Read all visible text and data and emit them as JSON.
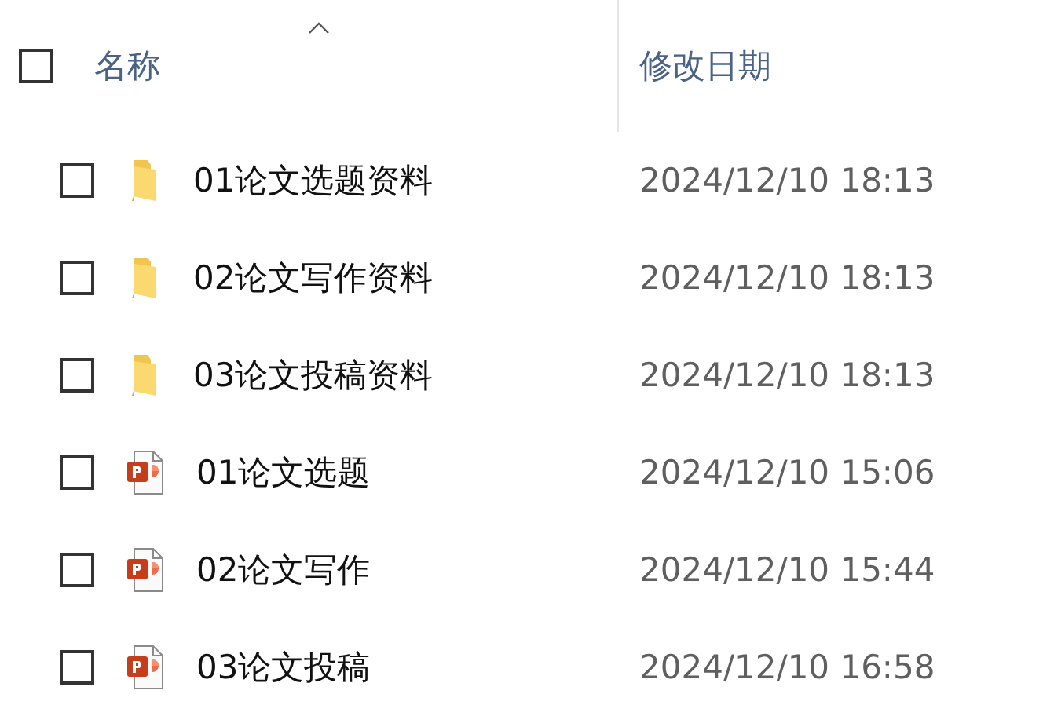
{
  "header": {
    "checked": false,
    "columns": [
      {
        "label": "名称",
        "sorted": true
      },
      {
        "label": "修改日期",
        "sorted": false
      }
    ]
  },
  "files": [
    {
      "kind": "folder",
      "name": "01论文选题资料",
      "modified": "2024/12/10 18:13",
      "checked": false
    },
    {
      "kind": "folder",
      "name": "02论文写作资料",
      "modified": "2024/12/10 18:13",
      "checked": false
    },
    {
      "kind": "folder",
      "name": "03论文投稿资料",
      "modified": "2024/12/10 18:13",
      "checked": false
    },
    {
      "kind": "presentation",
      "name": "01论文选题",
      "modified": "2024/12/10 15:06",
      "checked": false
    },
    {
      "kind": "presentation",
      "name": "02论文写作",
      "modified": "2024/12/10 15:44",
      "checked": false
    },
    {
      "kind": "presentation",
      "name": "03论文投稿",
      "modified": "2024/12/10 16:58",
      "checked": false
    }
  ]
}
